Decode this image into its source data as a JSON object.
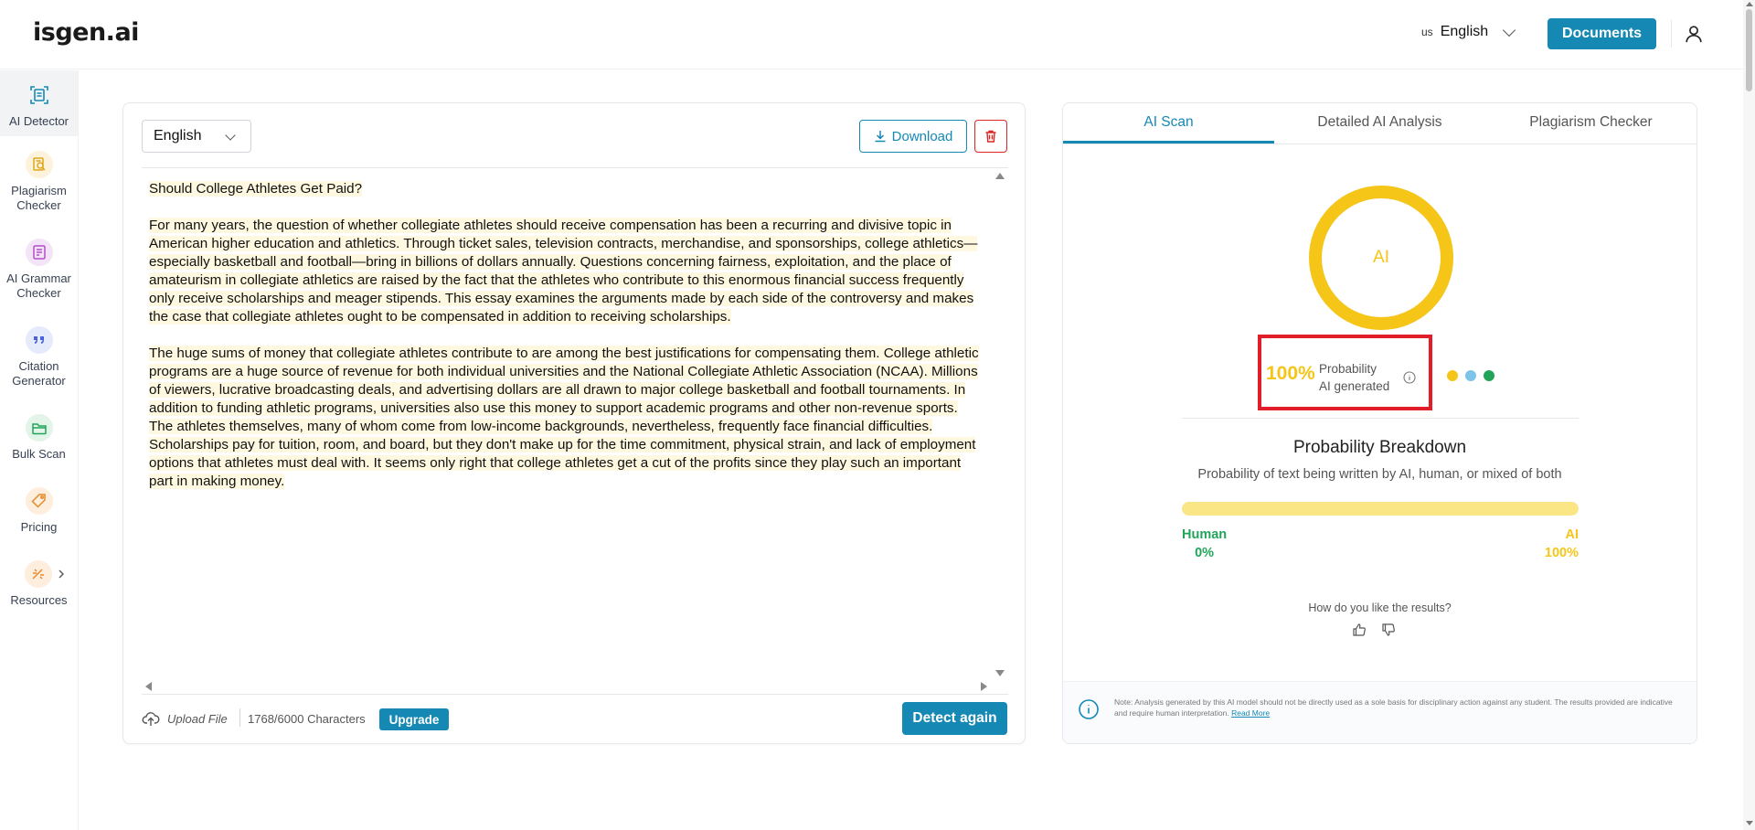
{
  "header": {
    "logo": "isgen.ai",
    "language_flag": "us",
    "language": "English",
    "documents_label": "Documents"
  },
  "sidebar": {
    "items": [
      {
        "label": "AI Detector",
        "icon": "ai-detector-icon",
        "active": true
      },
      {
        "label": "Plagiarism Checker",
        "icon": "plagiarism-icon"
      },
      {
        "label": "AI Grammar Checker",
        "icon": "grammar-icon"
      },
      {
        "label": "Citation Generator",
        "icon": "citation-icon"
      },
      {
        "label": "Bulk Scan",
        "icon": "folder-icon"
      },
      {
        "label": "Pricing",
        "icon": "tag-icon"
      },
      {
        "label": "Resources",
        "icon": "resources-icon"
      }
    ]
  },
  "editor": {
    "language": "English",
    "download_label": "Download",
    "title": "Should College Athletes Get Paid?",
    "paragraph1": "For many years, the question of whether collegiate athletes should receive compensation has been a recurring and divisive topic in American higher education and athletics. Through ticket sales, television contracts, merchandise, and sponsorships, college athletics—especially basketball and football—bring in billions of dollars annually. Questions concerning fairness, exploitation, and the place of amateurism in collegiate athletics are raised by the fact that the athletes who contribute to this enormous financial success frequently only receive scholarships and meager stipends. This essay examines the arguments made by each side of the controversy and makes the case that collegiate athletes ought to be compensated in addition to receiving scholarships.",
    "paragraph2": "The huge sums of money that collegiate athletes contribute to are among the best justifications for compensating them. College athletic programs are a huge source of revenue for both individual universities and the National Collegiate Athletic Association (NCAA). Millions of viewers, lucrative broadcasting deals, and advertising dollars are all drawn to major college basketball and football tournaments. In addition to funding athletic programs, universities also use this money to support academic programs and other non-revenue sports. The athletes themselves, many of whom come from low-income backgrounds, nevertheless, frequently face financial difficulties. Scholarships pay for tuition, room, and board, but they don't make up for the time commitment, physical strain, and lack of employment options that athletes must deal with. It seems only right that college athletes get a cut of the profits since they play such an important part in making money.",
    "upload_label": "Upload File",
    "char_count": "1768/6000 Characters",
    "upgrade_label": "Upgrade",
    "detect_label": "Detect again"
  },
  "results": {
    "tabs": [
      "AI Scan",
      "Detailed AI Analysis",
      "Plagiarism Checker"
    ],
    "active_tab": 0,
    "donut_label": "AI",
    "ai_fraction": 1.0,
    "probability_pct": "100%",
    "probability_line1": "Probability",
    "probability_line2": "AI generated",
    "legend_dots": [
      "#f5c518",
      "#7cc4ea",
      "#22a55a"
    ],
    "breakdown_title": "Probability Breakdown",
    "breakdown_subtitle": "Probability of text being written by AI, human, or mixed of both",
    "human_label": "Human",
    "human_pct": "0%",
    "ai_label": "AI",
    "ai_pct": "100%",
    "feedback_question": "How do you like the results?",
    "note": "Note: Analysis generated by this AI model should not be directly used as a sole basis for disciplinary action against any student. The results provided are indicative and require human interpretation.",
    "read_more": "Read More"
  },
  "colors": {
    "accent": "#1589b4",
    "ai_yellow": "#f5c518",
    "human_green": "#22a55a",
    "highlight_red": "#e11d2a"
  }
}
